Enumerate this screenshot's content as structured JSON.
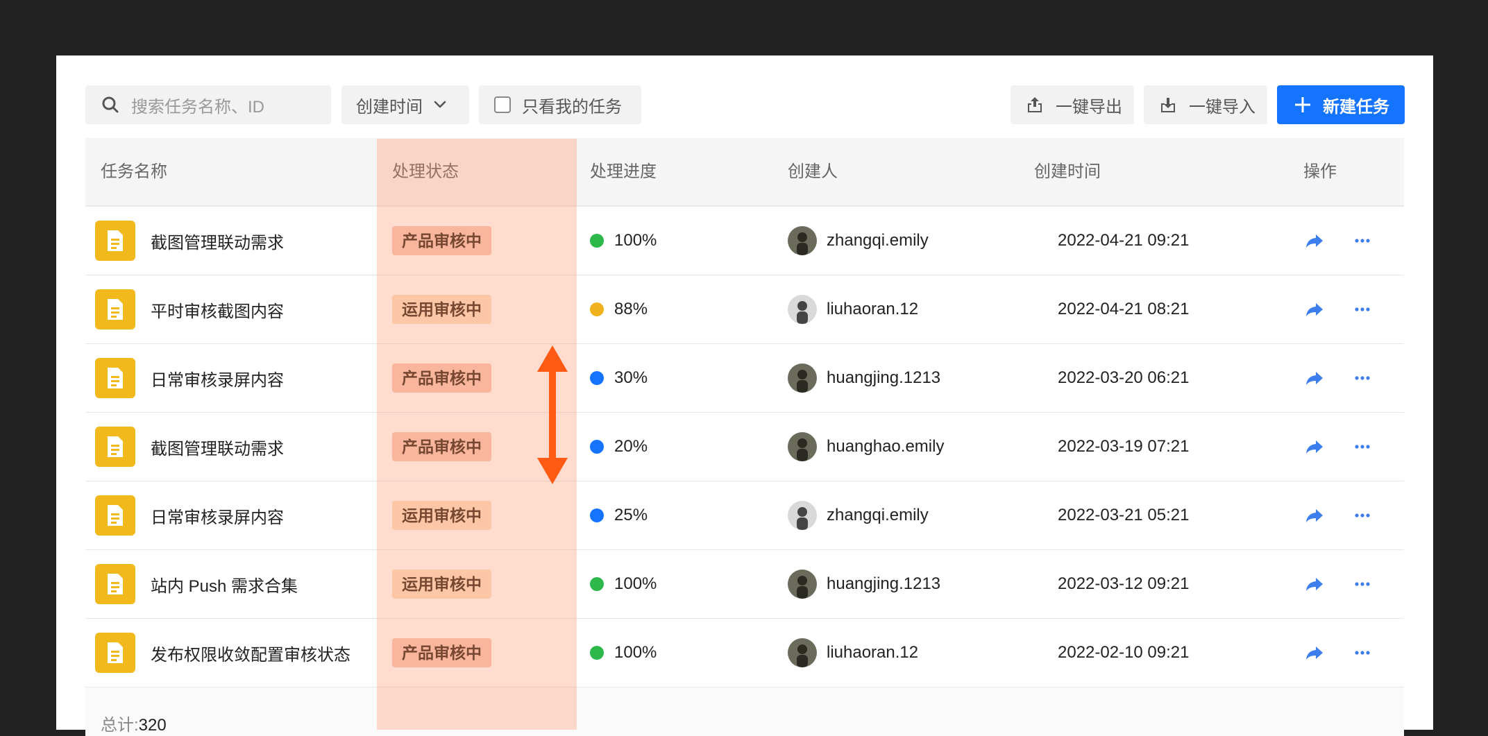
{
  "toolbar": {
    "search_placeholder": "搜索任务名称、ID",
    "date_filter_label": "创建时间",
    "only_mine_label": "只看我的任务",
    "export_label": "一键导出",
    "import_label": "一键导入",
    "new_task_label": "新建任务"
  },
  "table": {
    "headers": {
      "name": "任务名称",
      "status": "处理状态",
      "progress": "处理进度",
      "creator": "创建人",
      "created_at": "创建时间",
      "actions": "操作"
    },
    "rows": [
      {
        "name": "截图管理联动需求",
        "status": "产品审核中",
        "status_type": "product",
        "progress": "100%",
        "progress_color": "#2eb84b",
        "creator": "zhangqi.emily",
        "created_at": "2022-04-21 09:21"
      },
      {
        "name": "平时审核截图内容",
        "status": "运用审核中",
        "status_type": "ops",
        "progress": "88%",
        "progress_color": "#f0b21c",
        "creator": "liuhaoran.12",
        "created_at": "2022-04-21 08:21"
      },
      {
        "name": "日常审核录屏内容",
        "status": "产品审核中",
        "status_type": "product",
        "progress": "30%",
        "progress_color": "#1473ff",
        "creator": "huangjing.1213",
        "created_at": "2022-03-20 06:21"
      },
      {
        "name": "截图管理联动需求",
        "status": "产品审核中",
        "status_type": "product",
        "progress": "20%",
        "progress_color": "#1473ff",
        "creator": "huanghao.emily",
        "created_at": "2022-03-19 07:21"
      },
      {
        "name": "日常审核录屏内容",
        "status": "运用审核中",
        "status_type": "ops",
        "progress": "25%",
        "progress_color": "#1473ff",
        "creator": "zhangqi.emily",
        "created_at": "2022-03-21 05:21"
      },
      {
        "name": "站内 Push 需求合集",
        "status": "运用审核中",
        "status_type": "ops",
        "progress": "100%",
        "progress_color": "#2eb84b",
        "creator": "huangjing.1213",
        "created_at": "2022-03-12 09:21"
      },
      {
        "name": "发布权限收敛配置审核状态",
        "status": "产品审核中",
        "status_type": "product",
        "progress": "100%",
        "progress_color": "#2eb84b",
        "creator": "liuhaoran.12",
        "created_at": "2022-02-10 09:21"
      }
    ],
    "footer": {
      "total_label": "总计:",
      "total_value": "320"
    }
  },
  "colors": {
    "primary": "#1473ff",
    "doc_icon": "#f2b91d",
    "status_product_bg": "#f7c9bb",
    "status_ops_bg": "#fde0c8",
    "highlight": "#ff8c5a",
    "arrow": "#ff5a14"
  },
  "icons": {
    "search": "search-icon",
    "chevron": "chevron-down-icon",
    "export": "export-icon",
    "import": "import-icon",
    "plus": "plus-icon",
    "document": "document-icon",
    "share": "share-icon",
    "more": "more-icon"
  }
}
